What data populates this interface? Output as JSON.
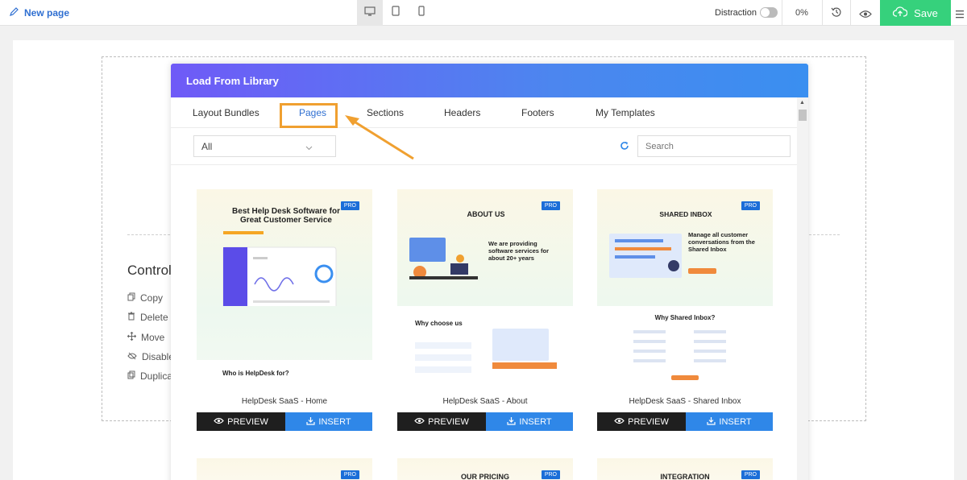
{
  "topbar": {
    "page_name": "New page",
    "distraction_label": "Distraction",
    "zoom_percent": "0%",
    "save_label": "Save"
  },
  "controls": {
    "title": "Control",
    "items": [
      "Copy",
      "Delete",
      "Move",
      "Disable",
      "Duplica"
    ]
  },
  "modal": {
    "title": "Load From Library",
    "tabs": [
      "Layout Bundles",
      "Pages",
      "Sections",
      "Headers",
      "Footers",
      "My Templates"
    ],
    "active_tab": "Pages",
    "filter_value": "All",
    "search_placeholder": "Search",
    "preview_label": "PREVIEW",
    "insert_label": "INSERT",
    "pro_badge": "PRO",
    "cards": [
      {
        "name": "HelpDesk SaaS - Home",
        "heading": "Best Help Desk Software for Great Customer Service",
        "sub_heading": "Who is HelpDesk for?"
      },
      {
        "name": "HelpDesk SaaS - About",
        "heading": "ABOUT US",
        "tagline": "We are providing software services for about 20+ years",
        "sub_heading": "Why choose us"
      },
      {
        "name": "HelpDesk SaaS - Shared Inbox",
        "heading": "SHARED INBOX",
        "tagline": "Manage all customer conversations from the Shared Inbox",
        "sub_heading": "Why Shared Inbox?"
      }
    ],
    "next_row": [
      "",
      "OUR PRICING",
      "INTEGRATION"
    ]
  },
  "colors": {
    "accent": "#2f6fd1",
    "save_green": "#36d17c",
    "highlight_orange": "#f0a030",
    "insert_blue": "#2f87e8",
    "pro_blue": "#1b6ed8"
  }
}
